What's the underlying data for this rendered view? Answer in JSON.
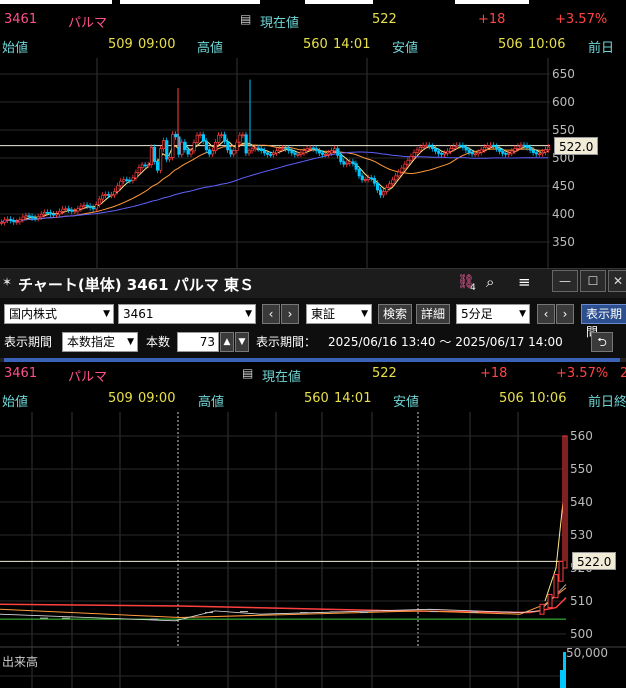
{
  "top_panel": {
    "quote": {
      "code": "3461",
      "name": "パルマ",
      "current_label": "現在値",
      "current_value": "522",
      "change": "+18",
      "change_pct": "+3.57%"
    },
    "ohlc": {
      "open_label": "始値",
      "open_value": "509",
      "open_time": "09:00",
      "high_label": "高値",
      "high_value": "560",
      "high_time": "14:01",
      "low_label": "安値",
      "low_value": "506",
      "low_time": "10:06",
      "prev_label": "前日"
    },
    "y_ticks": [
      "650",
      "600",
      "550",
      "500",
      "450",
      "400",
      "350"
    ],
    "price_tag": "522.0"
  },
  "window": {
    "title": "チャート(単体) 3461 パルマ 東Ｓ",
    "pin_icon": "✶",
    "link_badge": "4"
  },
  "toolbar": {
    "market": "国内株式",
    "code": "3461",
    "exchange": "東証",
    "search_label": "検索",
    "detail_label": "詳細",
    "interval": "5分足",
    "display_label": "表示期間",
    "period_mode": "本数指定",
    "count_label": "本数",
    "count_value": "73",
    "period_text_label": "表示期間：",
    "period_range": "2025/06/16 13:40 〜 2025/06/17 14:00",
    "display_button": "表示期間"
  },
  "bottom_panel": {
    "quote": {
      "code": "3461",
      "name": "パルマ",
      "current_label": "現在値",
      "current_value": "522",
      "change": "+18",
      "change_pct": "+3.57%",
      "extra": "2"
    },
    "ohlc": {
      "open_label": "始値",
      "open_value": "509",
      "open_time": "09:00",
      "high_label": "高値",
      "high_value": "560",
      "high_time": "14:01",
      "low_label": "安値",
      "low_value": "506",
      "low_time": "10:06",
      "prev_label": "前日終"
    },
    "y_ticks": [
      "560",
      "550",
      "540",
      "530",
      "520",
      "510",
      "500"
    ],
    "price_tag": "522.0",
    "volume_label": "出来高",
    "volume_tick": "50,000"
  },
  "colors": {
    "candle_up": "#ff4040",
    "candle_down": "#00c8ff",
    "ma_short": "#ffee88",
    "ma_mid": "#ff9a3c",
    "ma_long": "#6060ff",
    "bg": "#000000"
  }
}
